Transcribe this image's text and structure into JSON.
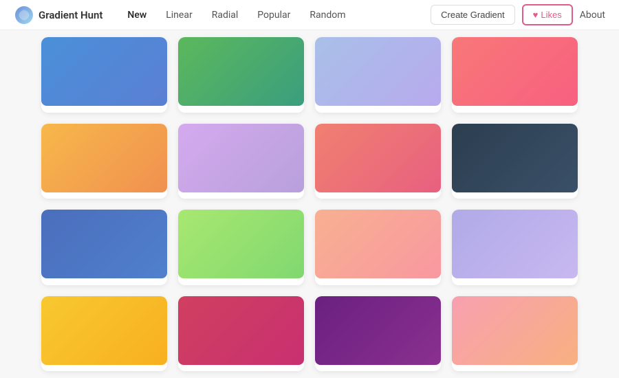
{
  "header": {
    "logo_text": "Gradient Hunt",
    "nav_items": [
      {
        "label": "New",
        "active": true
      },
      {
        "label": "Linear",
        "active": false
      },
      {
        "label": "Radial",
        "active": false
      },
      {
        "label": "Popular",
        "active": false
      },
      {
        "label": "Random",
        "active": false
      }
    ],
    "create_btn_label": "Create Gradient",
    "likes_btn_label": "Likes",
    "about_label": "About"
  },
  "gradients": [
    {
      "id": 1,
      "gradient": "linear-gradient(135deg, #4a90d9 0%, #5b7fd4 100%)"
    },
    {
      "id": 2,
      "gradient": "linear-gradient(135deg, #5cb85c 0%, #3a9e7e 100%)"
    },
    {
      "id": 3,
      "gradient": "linear-gradient(135deg, #a8c0e8 0%, #b8aaee 100%)"
    },
    {
      "id": 4,
      "gradient": "linear-gradient(135deg, #f87878 0%, #f86080 100%)"
    },
    {
      "id": 5,
      "gradient": "linear-gradient(135deg, #f7b84a 0%, #f09050 100%)"
    },
    {
      "id": 6,
      "gradient": "linear-gradient(135deg, #d4aaee 0%, #b8a0dc 100%)"
    },
    {
      "id": 7,
      "gradient": "linear-gradient(135deg, #f08070 0%, #e86080 100%)"
    },
    {
      "id": 8,
      "gradient": "linear-gradient(135deg, #2c3e50 0%, #3a5068 100%)"
    },
    {
      "id": 9,
      "gradient": "linear-gradient(135deg, #4a6ebc 0%, #5080cc 100%)"
    },
    {
      "id": 10,
      "gradient": "linear-gradient(135deg, #a8e870 0%, #80d870 100%)"
    },
    {
      "id": 11,
      "gradient": "linear-gradient(135deg, #f8b090 0%, #f898a0 100%)"
    },
    {
      "id": 12,
      "gradient": "linear-gradient(135deg, #b0aae8 0%, #c8b8f0 100%)"
    },
    {
      "id": 13,
      "gradient": "linear-gradient(135deg, #f8c830 0%, #f8b020 100%)"
    },
    {
      "id": 14,
      "gradient": "linear-gradient(135deg, #d04060 0%, #c83070 100%)"
    },
    {
      "id": 15,
      "gradient": "linear-gradient(135deg, #6a2080 0%, #8a3090 100%)"
    },
    {
      "id": 16,
      "gradient": "linear-gradient(135deg, #f8a0b0 0%, #f8b080 100%)"
    }
  ]
}
